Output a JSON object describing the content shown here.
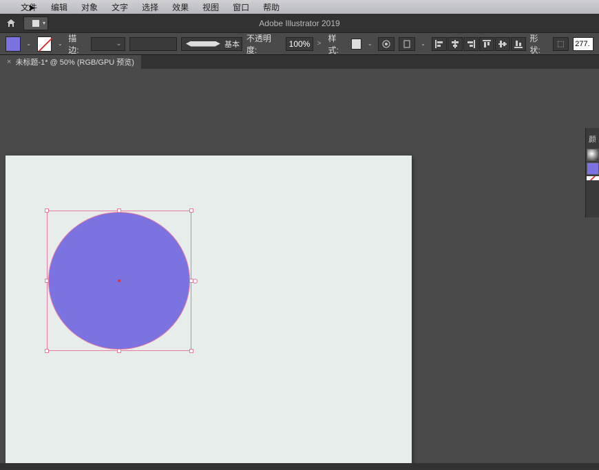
{
  "menu": {
    "file": "文件",
    "edit": "编辑",
    "object": "对象",
    "type": "文字",
    "select": "选择",
    "effect": "效果",
    "view": "视图",
    "window": "窗口",
    "help": "帮助"
  },
  "app": {
    "title": "Adobe Illustrator 2019"
  },
  "controls": {
    "fill_color": "#7b73e0",
    "stroke_label": "描边:",
    "stroke_weight": "",
    "profile_label": "基本",
    "opacity_label": "不透明度:",
    "opacity_value": "100%",
    "style_label": "样式:",
    "shape_label": "形状:",
    "shape_width": "277."
  },
  "tab": {
    "title": "未标题-1* @ 50% (RGB/GPU 预览)",
    "close": "×"
  },
  "panel": {
    "tab": "颜"
  },
  "icons": {
    "home": "home-icon",
    "layout": "layout-icon",
    "dropdown": "⌄",
    "arrow": ">",
    "globe": "globe-icon",
    "doc": "doc-icon",
    "link": "link-icon"
  }
}
